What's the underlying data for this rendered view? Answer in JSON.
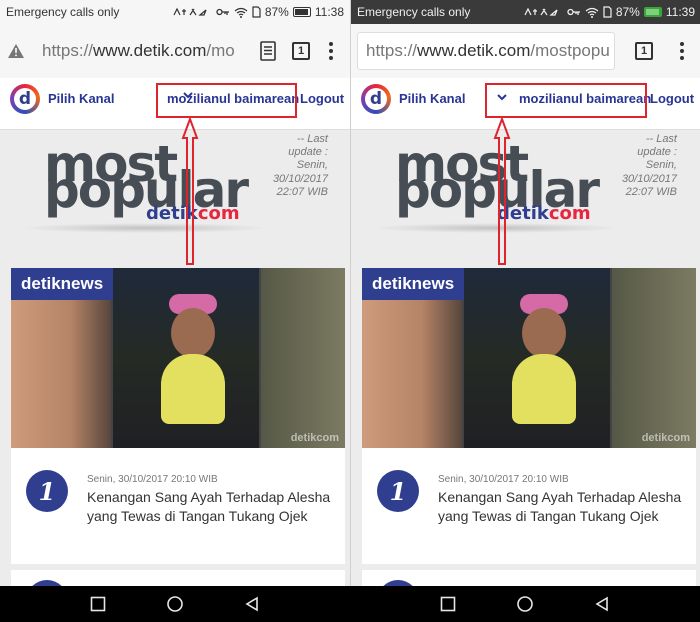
{
  "panels": [
    {
      "status": {
        "left_text": "Emergency calls only",
        "battery": "87%",
        "time": "11:38"
      },
      "url": {
        "prefix": "https://",
        "host": "www.detik.com",
        "path": "/mo"
      },
      "tab_count": "1",
      "header": {
        "pilih_kanal": "Pilih Kanal",
        "username": "mozilianul baimarean",
        "logout": "Logout"
      },
      "most_popular": {
        "line1": "most",
        "line2": "popular",
        "brand_detik": "detik",
        "brand_com": "com"
      },
      "last_update": [
        "-- Last",
        "update :",
        "Senin,",
        "30/10/2017",
        "22:07 WIB"
      ],
      "card": {
        "badge": "detiknews",
        "watermark": "detikcom",
        "rank": "1",
        "date": "Senin, 30/10/2017 20:10 WIB",
        "title": "Kenangan Sang Ayah Terhadap Alesha yang Tewas di Tangan Tukang Ojek"
      }
    },
    {
      "status": {
        "left_text": "Emergency calls only",
        "battery": "87%",
        "time": "11:39"
      },
      "url": {
        "prefix": "https://",
        "host": "www.detik.com",
        "path": "/mostpopu"
      },
      "tab_count": "1",
      "header": {
        "pilih_kanal": "Pilih Kanal",
        "username": "mozilianul baimarean",
        "logout": "Logout"
      },
      "most_popular": {
        "line1": "most",
        "line2": "popular",
        "brand_detik": "detik",
        "brand_com": "com"
      },
      "last_update": [
        "-- Last",
        "update :",
        "Senin,",
        "30/10/2017",
        "22:07 WIB"
      ],
      "card": {
        "badge": "detiknews",
        "watermark": "detikcom",
        "rank": "1",
        "date": "Senin, 30/10/2017 20:10 WIB",
        "title": "Kenangan Sang Ayah Terhadap Alesha yang Tewas di Tangan Tukang Ojek"
      }
    }
  ],
  "icons": {
    "status": [
      "key-icon",
      "wifi-icon",
      "sim-icon",
      "battery-icon"
    ],
    "nav": [
      "recent-apps-icon",
      "home-icon",
      "back-icon"
    ],
    "chevron": "chevron-down-icon"
  },
  "colors": {
    "brand_blue": "#2f3e8f",
    "brand_red": "#e8263d",
    "annotation_red": "#e0242e",
    "right_status_bg": "#3a3a3a"
  }
}
